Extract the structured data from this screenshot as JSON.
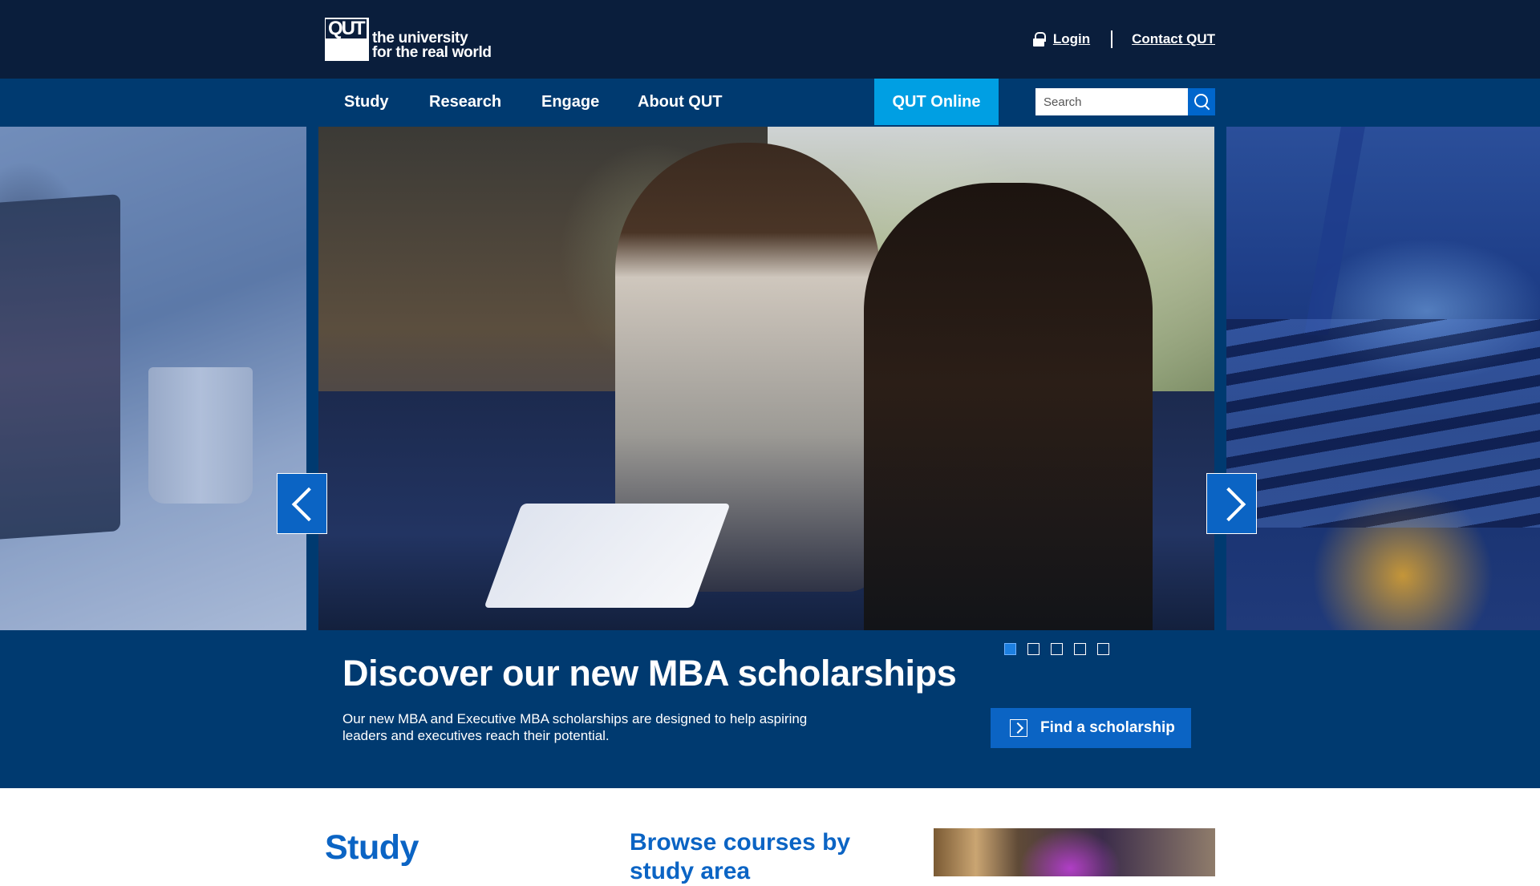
{
  "header": {
    "logo_mark": "QUT",
    "logo_line1": "the university",
    "logo_line2": "for the real world",
    "login_label": "Login",
    "contact_label": "Contact QUT"
  },
  "nav": {
    "items": [
      {
        "label": "Study"
      },
      {
        "label": "Research"
      },
      {
        "label": "Engage"
      },
      {
        "label": "About QUT"
      }
    ],
    "online_label": "QUT Online",
    "search_placeholder": "Search"
  },
  "carousel": {
    "title": "Discover our new MBA scholarships",
    "description": "Our new MBA and Executive MBA scholarships are designed to help aspiring leaders and executives reach their potential.",
    "cta_label": "Find a scholarship",
    "slide_count": 5,
    "active_slide": 1
  },
  "lower": {
    "study_heading": "Study",
    "browse_heading": "Browse courses by study area"
  },
  "colors": {
    "header_bg": "#0a1e3c",
    "nav_bg": "#003a70",
    "online_bg": "#009fe3",
    "accent_blue": "#0b64c4"
  }
}
